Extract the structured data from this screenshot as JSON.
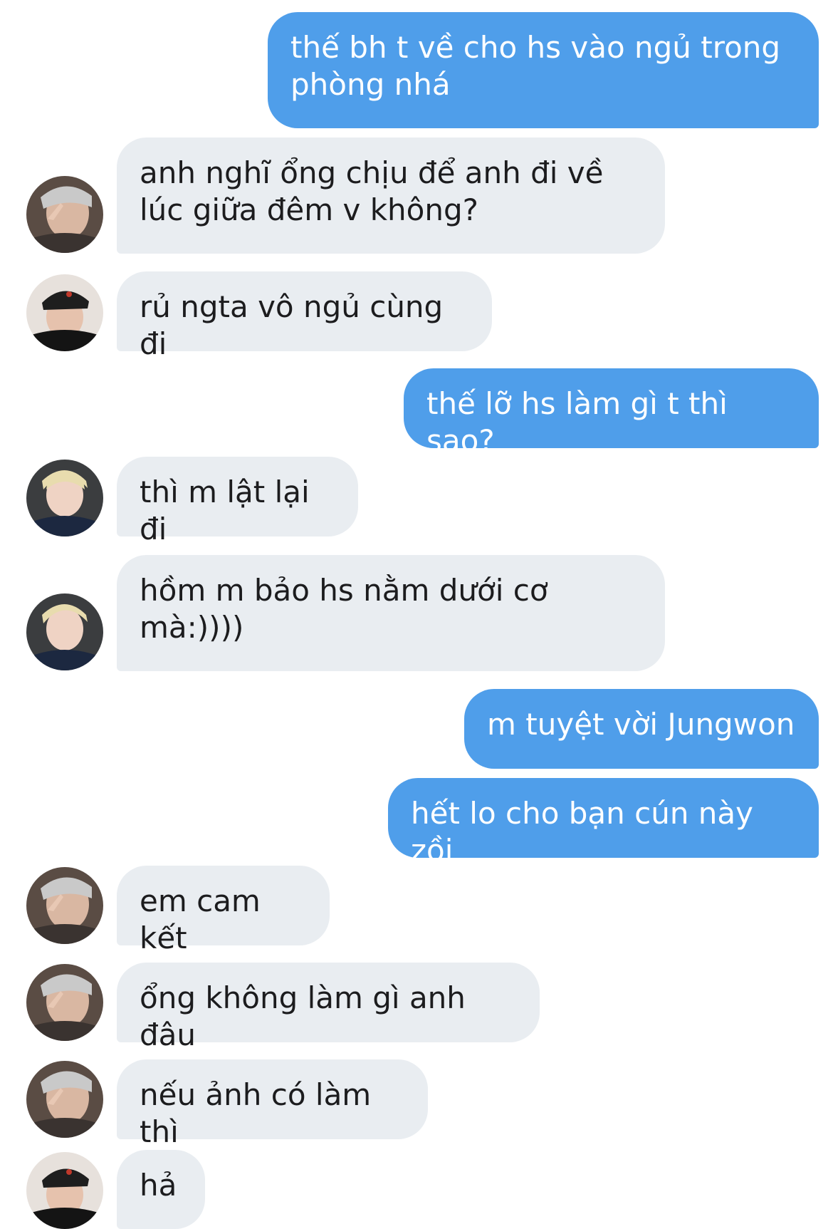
{
  "conversation": {
    "messages": [
      {
        "side": "out",
        "text": "thế bh t về cho hs vào ngủ trong phòng nhá"
      },
      {
        "side": "in",
        "avatar": "avatar-a",
        "text": "anh nghĩ ổng chịu để anh đi về lúc giữa đêm v không?"
      },
      {
        "side": "in",
        "avatar": "avatar-b",
        "text": "rủ ngta vô ngủ cùng đi"
      },
      {
        "side": "out",
        "text": "thế lỡ hs làm gì t thì sao?"
      },
      {
        "side": "in",
        "avatar": "avatar-c",
        "text": "thì m lật lại đi"
      },
      {
        "side": "in",
        "avatar": "avatar-c",
        "text": "hồm m bảo hs nằm dưới cơ mà:))))"
      },
      {
        "side": "out",
        "text": "m tuyệt vời Jungwon"
      },
      {
        "side": "out",
        "text": "hết lo cho bạn cún này zồi"
      },
      {
        "side": "in",
        "avatar": "avatar-a",
        "text": "em cam kết"
      },
      {
        "side": "in",
        "avatar": "avatar-a",
        "text": "ổng không làm gì anh đâu"
      },
      {
        "side": "in",
        "avatar": "avatar-a",
        "text": "nếu ảnh có làm thì"
      },
      {
        "side": "in",
        "avatar": "avatar-b",
        "text": "hả"
      }
    ]
  },
  "colors": {
    "outgoing_bubble": "#4f9eea",
    "incoming_bubble": "#e9edf1",
    "outgoing_text": "#ffffff",
    "incoming_text": "#1c1c1e"
  }
}
